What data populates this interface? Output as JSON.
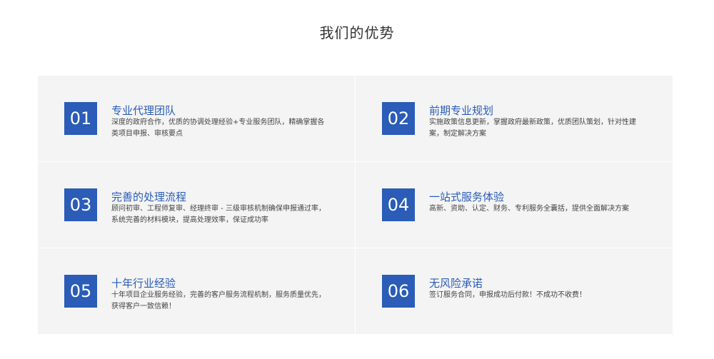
{
  "section": {
    "title": "我们的优势"
  },
  "colors": {
    "accent": "#2a5cb8",
    "card_bg": "#f4f4f4",
    "text": "#333333"
  },
  "advantages": [
    {
      "number": "01",
      "title": "专业代理团队",
      "desc": "深度的政府合作，优质的协调处理经验+专业服务团队，精确掌握各类项目申报、审核要点"
    },
    {
      "number": "02",
      "title": "前期专业规划",
      "desc": "实施政策信息更新，掌握政府最新政策，优质团队策划，针对性建案，制定解决方案"
    },
    {
      "number": "03",
      "title": "完善的处理流程",
      "desc": "顾问初审、工程师复审、经理终审 - 三级审核机制确保申报通过率，系统完善的材料模块，提高处理效率，保证成功率"
    },
    {
      "number": "04",
      "title": "一站式服务体验",
      "desc": "高新、资助、认定、财务、专利服务全囊括，提供全面解决方案"
    },
    {
      "number": "05",
      "title": "十年行业经验",
      "desc": "十年项目企业服务经验，完善的客户服务流程机制，服务质量优先，获得客户一致信赖！"
    },
    {
      "number": "06",
      "title": "无风险承诺",
      "desc": "签订服务合同，申报成功后付款！不成功不收费！"
    }
  ]
}
